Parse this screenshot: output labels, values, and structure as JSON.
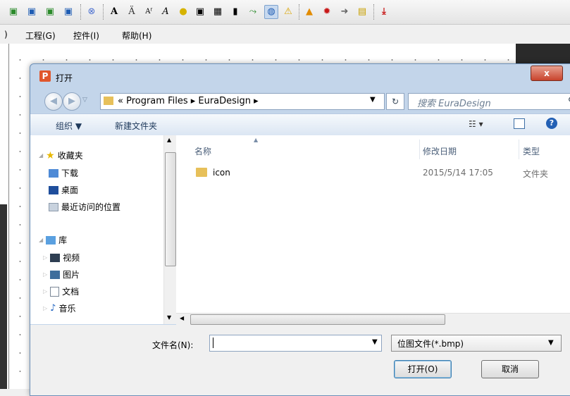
{
  "toolbar": {
    "icons": [
      "layer-icon",
      "layer-icon",
      "layer-icon",
      "layer-icon",
      "target-icon",
      "text-icon",
      "text-outline-icon",
      "text-small-icon",
      "text-italic-icon",
      "bulb-icon",
      "frame-icon",
      "grid-icon",
      "tube-icon",
      "chart-icon",
      "palette-icon",
      "warning-icon",
      "alarm-icon",
      "gear-icon",
      "export-icon",
      "lock-icon",
      "download-icon"
    ]
  },
  "menu": {
    "items": [
      ")",
      "工程(G)",
      "控件(I)",
      "帮助(H)"
    ]
  },
  "dialog": {
    "title": "打开",
    "close_label": "x",
    "address": "« Program Files ▸ EuraDesign ▸",
    "search_placeholder": "搜索 EuraDesign",
    "commands": {
      "organize": "组织 ▼",
      "new_folder": "新建文件夹"
    },
    "nav": {
      "favorites": "收藏夹",
      "downloads": "下载",
      "desktop": "桌面",
      "recent": "最近访问的位置",
      "library": "库",
      "videos": "视频",
      "pictures": "图片",
      "documents": "文档",
      "music": "音乐"
    },
    "columns": {
      "name": "名称",
      "modified": "修改日期",
      "type": "类型"
    },
    "files": [
      {
        "name": "icon",
        "modified": "2015/5/14 17:05",
        "type": "文件夹"
      }
    ],
    "filename_label": "文件名(N):",
    "filename_value": "",
    "filetype_value": "位图文件(*.bmp)",
    "open_button": "打开(O)",
    "cancel_button": "取消"
  }
}
